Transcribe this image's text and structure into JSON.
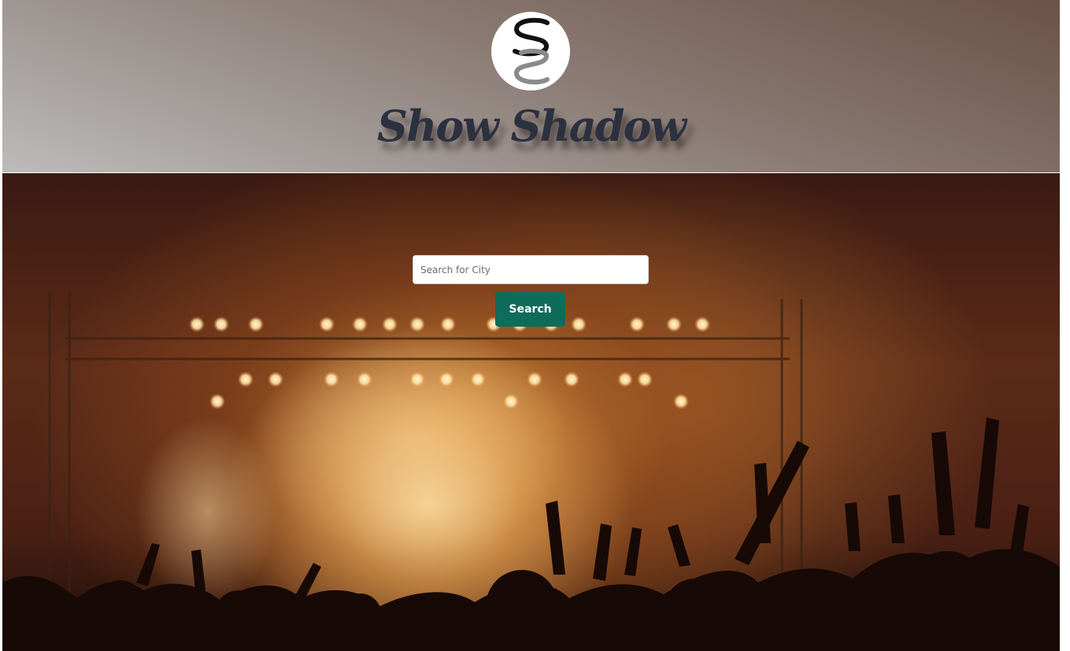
{
  "header": {
    "logo_icon": "ss-monogram-icon",
    "title": "Show Shadow"
  },
  "hero": {
    "background_icon": "concert-crowd-image",
    "search": {
      "placeholder": "Search for City",
      "value": ""
    },
    "search_button_label": "Search"
  },
  "colors": {
    "button": "#0f6b5a",
    "title": "#2c3140"
  }
}
